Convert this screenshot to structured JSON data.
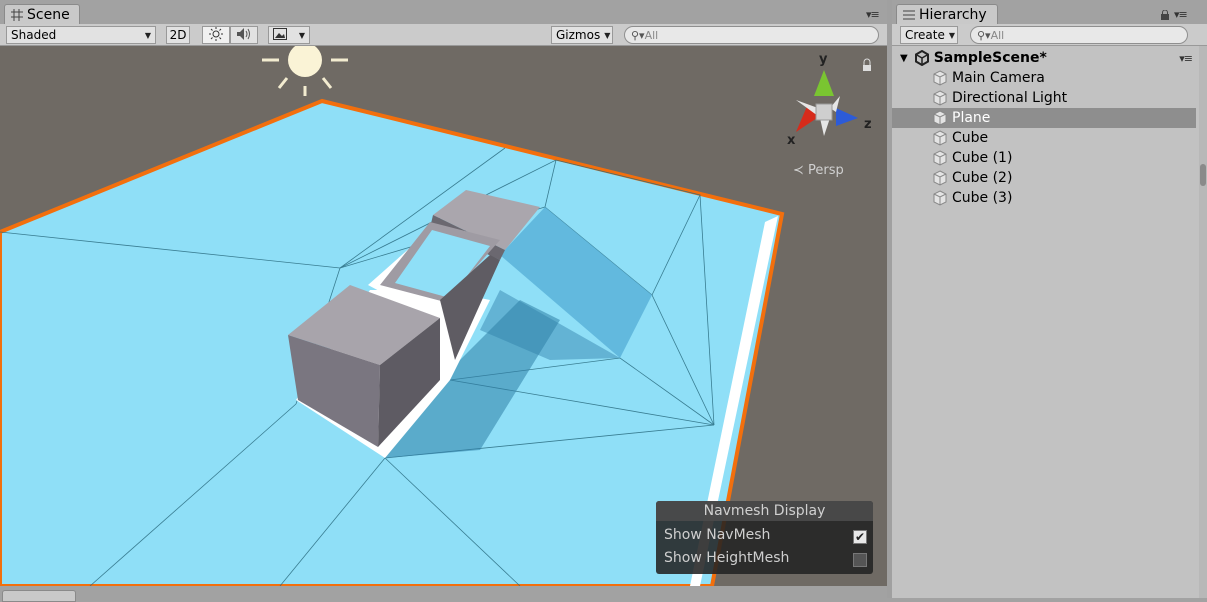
{
  "scene_tab": {
    "label": "Scene"
  },
  "scene_toolbar": {
    "draw_mode": "Shaded",
    "mode_2d": "2D",
    "gizmos_label": "Gizmos",
    "search_placeholder": "All"
  },
  "viewport": {
    "axis_y": "y",
    "axis_x": "x",
    "axis_z": "z",
    "projection_label": "Persp"
  },
  "navmesh_display": {
    "title": "Navmesh Display",
    "show_navmesh_label": "Show NavMesh",
    "show_navmesh_checked": true,
    "show_heightmesh_label": "Show HeightMesh",
    "show_heightmesh_checked": false
  },
  "hierarchy_tab": {
    "label": "Hierarchy"
  },
  "hierarchy_toolbar": {
    "create_label": "Create",
    "search_placeholder": "All"
  },
  "hierarchy": {
    "scene_name": "SampleScene*",
    "items": [
      {
        "label": "Main Camera",
        "selected": false
      },
      {
        "label": "Directional Light",
        "selected": false
      },
      {
        "label": "Plane",
        "selected": true
      },
      {
        "label": "Cube",
        "selected": false
      },
      {
        "label": "Cube (1)",
        "selected": false
      },
      {
        "label": "Cube (2)",
        "selected": false
      },
      {
        "label": "Cube (3)",
        "selected": false
      }
    ]
  },
  "colors": {
    "plane": "#8fdff7",
    "selection_outline": "#f26f0d",
    "viewport_bg": "#6f6a64",
    "selected_row": "#8e8e8e"
  }
}
